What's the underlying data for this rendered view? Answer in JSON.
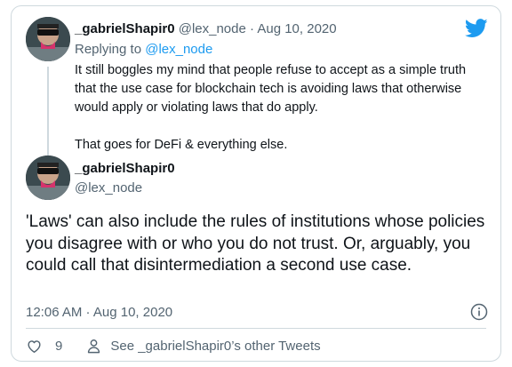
{
  "colors": {
    "brand_blue": "#1d9bf0",
    "text_primary": "#0f1419",
    "text_secondary": "#536471",
    "border": "#cfd9de"
  },
  "parent_tweet": {
    "display_name": "_gabrielShapir0",
    "handle": "@lex_node",
    "separator": "·",
    "date": "Aug 10, 2020",
    "replying_prefix": "Replying to",
    "replying_handle": "@lex_node",
    "text_lines": [
      "It still boggles my mind that people refuse to accept as a simple truth that the use case for blockchain tech is avoiding laws that otherwise would apply or violating laws that do apply.",
      "That goes for DeFi & everything else."
    ]
  },
  "main_tweet": {
    "display_name": "_gabrielShapir0",
    "handle": "@lex_node",
    "text": "'Laws' can also include the rules of institutions whose policies you disagree with or who you do not trust. Or, arguably, you could call that disintermediation a second use case.",
    "timestamp": "12:06 AM · Aug 10, 2020"
  },
  "actions": {
    "like_count": "9",
    "see_tweets_label": "See _gabrielShapir0’s other Tweets"
  },
  "icons": {
    "logo": "twitter-bird-icon",
    "info": "info-icon",
    "like": "heart-icon",
    "profile": "person-icon"
  }
}
